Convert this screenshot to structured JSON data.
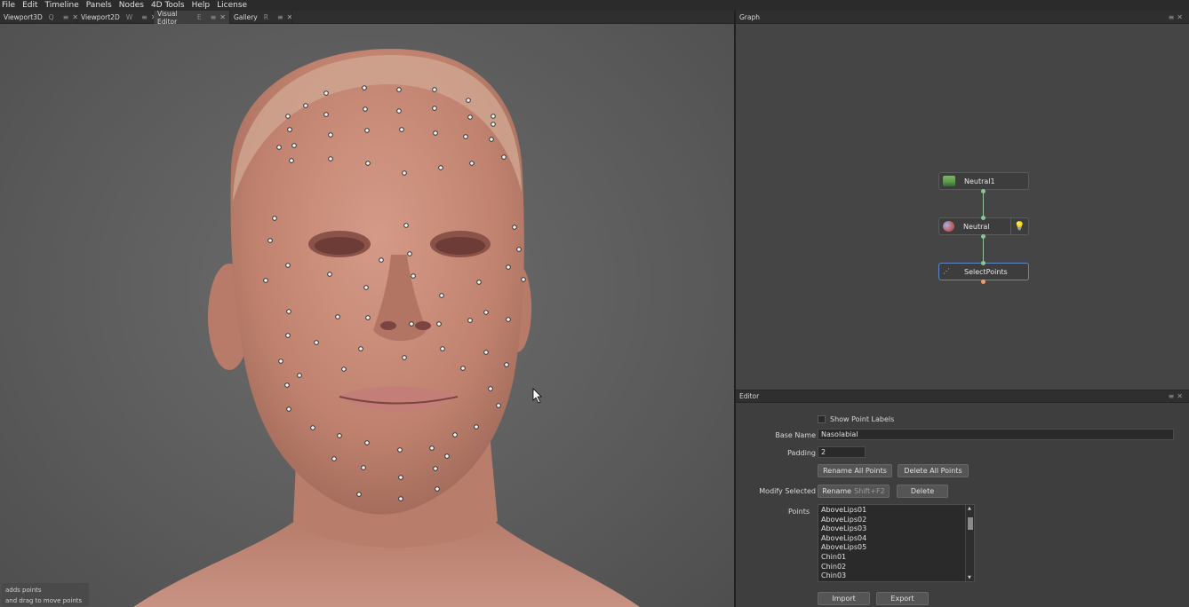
{
  "menu": [
    "File",
    "Edit",
    "Timeline",
    "Panels",
    "Nodes",
    "4D Tools",
    "Help",
    "License"
  ],
  "tabs": [
    {
      "label": "Viewport3D",
      "shortcut": "Q"
    },
    {
      "label": "Viewport2D",
      "shortcut": "W"
    },
    {
      "label": "Visual Editor",
      "shortcut": "E"
    },
    {
      "label": "Gallery",
      "shortcut": "R"
    }
  ],
  "viewport": {
    "hint_line1": "adds points",
    "hint_line2": "and drag to move points"
  },
  "graph": {
    "title": "Graph",
    "nodes": [
      {
        "label": "Neutral1",
        "icon": "image-icon"
      },
      {
        "label": "Neutral",
        "icon": "sphere-icon"
      },
      {
        "label": "SelectPoints",
        "icon": "select-points-icon"
      }
    ]
  },
  "editor": {
    "title": "Editor",
    "show_point_labels": "Show Point Labels",
    "base_name_label": "Base Name",
    "base_name_value": "Nasolabial",
    "padding_label": "Padding",
    "padding_value": "2",
    "rename_all": "Rename All Points",
    "delete_all": "Delete All Points",
    "modify_selected_label": "Modify Selected",
    "rename": "Rename",
    "rename_shortcut": "Shift+F2",
    "delete": "Delete",
    "points_label": "Points",
    "points": [
      "AboveLips01",
      "AboveLips02",
      "AboveLips03",
      "AboveLips04",
      "AboveLips05",
      "Chin01",
      "Chin02",
      "Chin03"
    ],
    "import": "Import",
    "export": "Export"
  },
  "colors": {
    "accent_select": "#5b89c5",
    "connector": "#8fc29a",
    "skin": "#c98c7a"
  }
}
